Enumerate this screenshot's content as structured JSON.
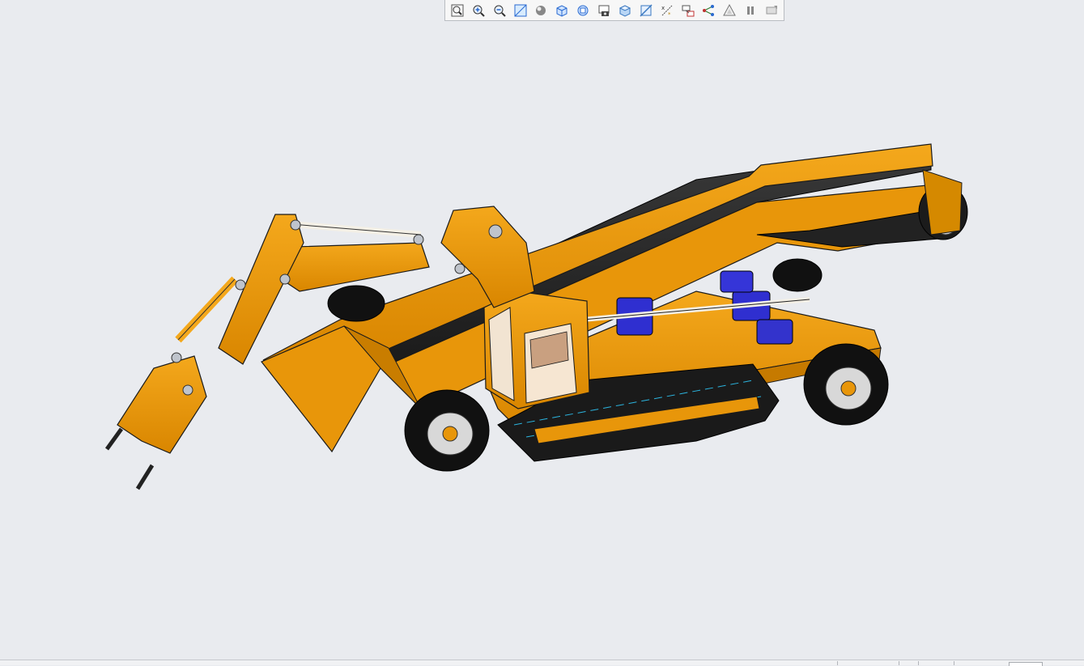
{
  "toolbar": {
    "buttons": [
      {
        "icon": "zoom-fit-icon"
      },
      {
        "icon": "zoom-in-icon"
      },
      {
        "icon": "zoom-out-icon"
      },
      {
        "icon": "zoom-area-icon"
      },
      {
        "icon": "shading-icon"
      },
      {
        "icon": "view-orientation-icon"
      },
      {
        "icon": "saved-views-icon"
      },
      {
        "icon": "snapshot-icon"
      },
      {
        "icon": "display-style-icon"
      },
      {
        "icon": "section-icon"
      },
      {
        "icon": "datum-display-icon"
      },
      {
        "icon": "annotation-display-icon"
      },
      {
        "icon": "spin-center-icon"
      },
      {
        "icon": "appearance-icon"
      },
      {
        "icon": "pause-icon"
      },
      {
        "icon": "repaint-icon"
      }
    ]
  },
  "colors": {
    "viewport_bg": "#e9ebef",
    "body_orange": "#e8960a",
    "body_shade": "#b86f00",
    "belt_dark": "#2a2a2a",
    "motor_blue": "#2f2fd0",
    "tire_black": "#111111",
    "rim_silver": "#d8d8d8",
    "cylinder_white": "#f4f0e6"
  }
}
